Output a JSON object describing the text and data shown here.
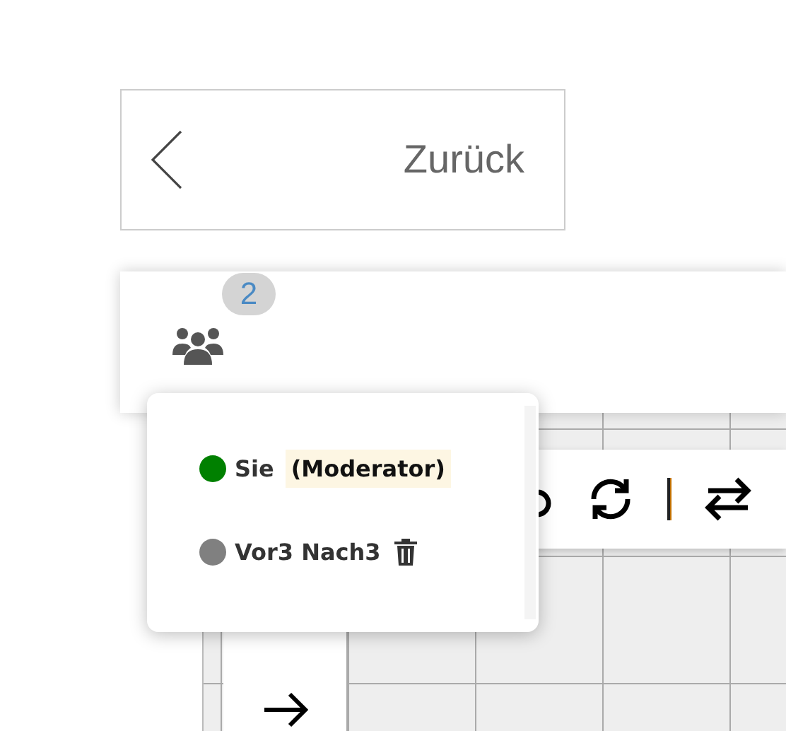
{
  "back_button": {
    "label": "Zurück"
  },
  "participants": {
    "count": "2",
    "items": [
      {
        "kind": "self",
        "name": "Sie",
        "role": "(Moderator)",
        "color": "#008000"
      },
      {
        "kind": "other",
        "name": "Vor3 Nach3",
        "color": "#808080"
      }
    ]
  }
}
